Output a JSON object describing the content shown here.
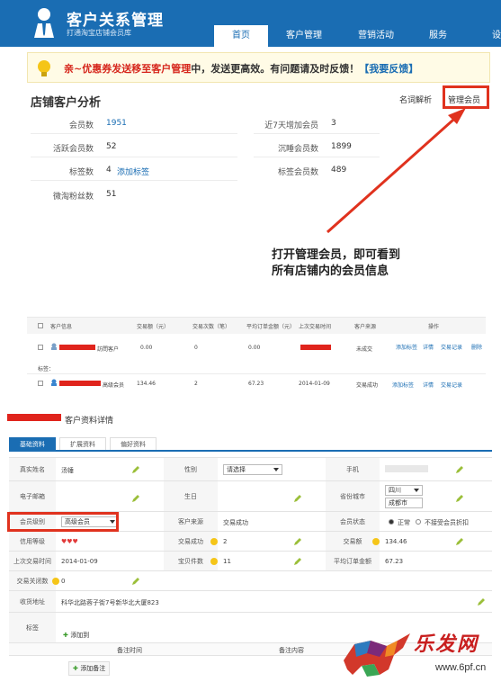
{
  "colors": {
    "brand_blue": "#1a6db3",
    "highlight_red": "#e0321e",
    "notice_bg": "#fffbe6"
  },
  "header": {
    "brand": "客户关系管理",
    "brand_sub": "打通淘宝店铺会员库",
    "nav": [
      "首页",
      "客户管理",
      "营销活动",
      "服务",
      "设"
    ],
    "active_nav": "首页"
  },
  "notice": {
    "prefix": "亲~优惠券发送移至",
    "highlight": "客户管理",
    "suffix": "中，发送更高效。有问题请及时反馈！",
    "feedback": "【我要反馈】"
  },
  "analysis": {
    "title": "店铺客户分析",
    "glossary_link": "名词解析",
    "manage_link": "管理会员",
    "left": [
      {
        "label": "会员数",
        "value": "1951"
      },
      {
        "label": "活跃会员数",
        "value": "52"
      },
      {
        "label": "标签数",
        "value": "4",
        "link": "添加标签"
      },
      {
        "label": "微淘粉丝数",
        "value": "51"
      }
    ],
    "right": [
      {
        "label": "近7天增加会员",
        "value": "3"
      },
      {
        "label": "沉睡会员数",
        "value": "1899"
      },
      {
        "label": "标签会员数",
        "value": "489"
      }
    ],
    "annotation_line1": "打开管理会员，即可看到",
    "annotation_line2": "所有店铺内的会员信息"
  },
  "member_table": {
    "headers": [
      "客户信息",
      "交易额（元）",
      "交易次数（笔）",
      "平均订单金额（元）",
      "上次交易时间",
      "客户来源",
      "操作"
    ],
    "rows": [
      {
        "name_suffix": "訪問客户",
        "amount": "0.00",
        "count": "0",
        "avg": "0.00",
        "last": "",
        "source": "未成交",
        "ops": [
          "添加标签",
          "详情",
          "交易记录",
          "删除"
        ],
        "tag_label": "标签："
      },
      {
        "name_suffix": "高级会员",
        "amount": "134.46",
        "count": "2",
        "avg": "67.23",
        "last": "2014-01-09",
        "source": "交易成功",
        "ops": [
          "添加标签",
          "详情",
          "交易记录"
        ]
      }
    ]
  },
  "detail": {
    "title": "客户资料详情",
    "tabs": [
      "基础资料",
      "扩展资料",
      "偏好资料"
    ],
    "fields": {
      "name_label": "真实姓名",
      "name_value": "汤锤",
      "gender_label": "性别",
      "gender_value": "请选择",
      "phone_label": "手机",
      "email_label": "电子邮箱",
      "birthday_label": "生日",
      "province_label": "省份城市",
      "province_value": "四川",
      "city_value": "成都市",
      "level_label": "会员级别",
      "level_value": "高级会员",
      "source_label": "客户来源",
      "source_value": "交易成功",
      "status_label": "会员状态",
      "status_on": "正常",
      "status_off": "不接受会员折扣",
      "credit_label": "信用等级",
      "credit_value": "♥♥♥",
      "trades_label": "交易成功",
      "trades_value": "2",
      "amount_label": "交易额",
      "amount_value": "134.46",
      "last_label": "上次交易时间",
      "last_value": "2014-01-09",
      "items_label": "宝贝件数",
      "items_value": "11",
      "avg_label": "平均订单金额",
      "avg_value": "67.23",
      "closed_label": "交易关闭数",
      "closed_value": "0",
      "address_label": "收货地址",
      "address_value": "科华北路蓉子街7号新华北大厦823",
      "tag_label": "标签",
      "add_tag": "添加到",
      "note_time": "备注时间",
      "note_content": "备注内容",
      "add_note": "添加备注"
    }
  },
  "watermark": {
    "text": "乐发网",
    "url": "www.6pf.cn"
  }
}
